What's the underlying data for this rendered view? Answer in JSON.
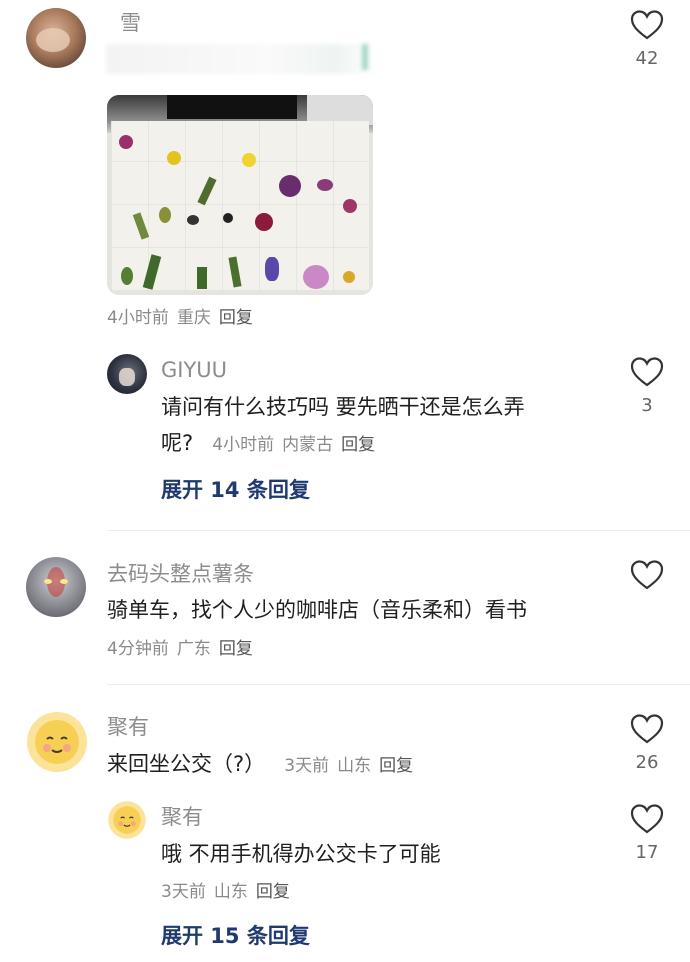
{
  "comments": [
    {
      "user": "雪",
      "text": "",
      "time": "4小时前",
      "location": "重庆",
      "reply_label": "回复",
      "likes": "42",
      "has_image": true,
      "replies": [
        {
          "user": "GIYUU",
          "text_line1": "请问有什么技巧吗 要先晒干还是怎么弄",
          "text_line2": "呢?",
          "time": "4小时前",
          "location": "内蒙古",
          "reply_label": "回复",
          "likes": "3"
        }
      ],
      "expand_label": "展开 14 条回复"
    },
    {
      "user": "去码头整点薯条",
      "text": "骑单车，找个人少的咖啡店（音乐柔和）看书",
      "time": "4分钟前",
      "location": "广东",
      "reply_label": "回复",
      "likes": ""
    },
    {
      "user": "聚有",
      "text": "来回坐公交（?）",
      "time": "3天前",
      "location": "山东",
      "reply_label": "回复",
      "likes": "26",
      "replies": [
        {
          "user": "聚有",
          "text": "哦 不用手机得办公交卡了可能",
          "time": "3天前",
          "location": "山东",
          "reply_label": "回复",
          "likes": "17"
        }
      ],
      "expand_label": "展开 15 条回复"
    }
  ],
  "colors": {
    "name": "#8c8c8c",
    "meta": "#8a8a8a",
    "expand": "#1f3a6e",
    "heart_stroke": "#333333"
  },
  "icons": [
    "heart-icon"
  ]
}
